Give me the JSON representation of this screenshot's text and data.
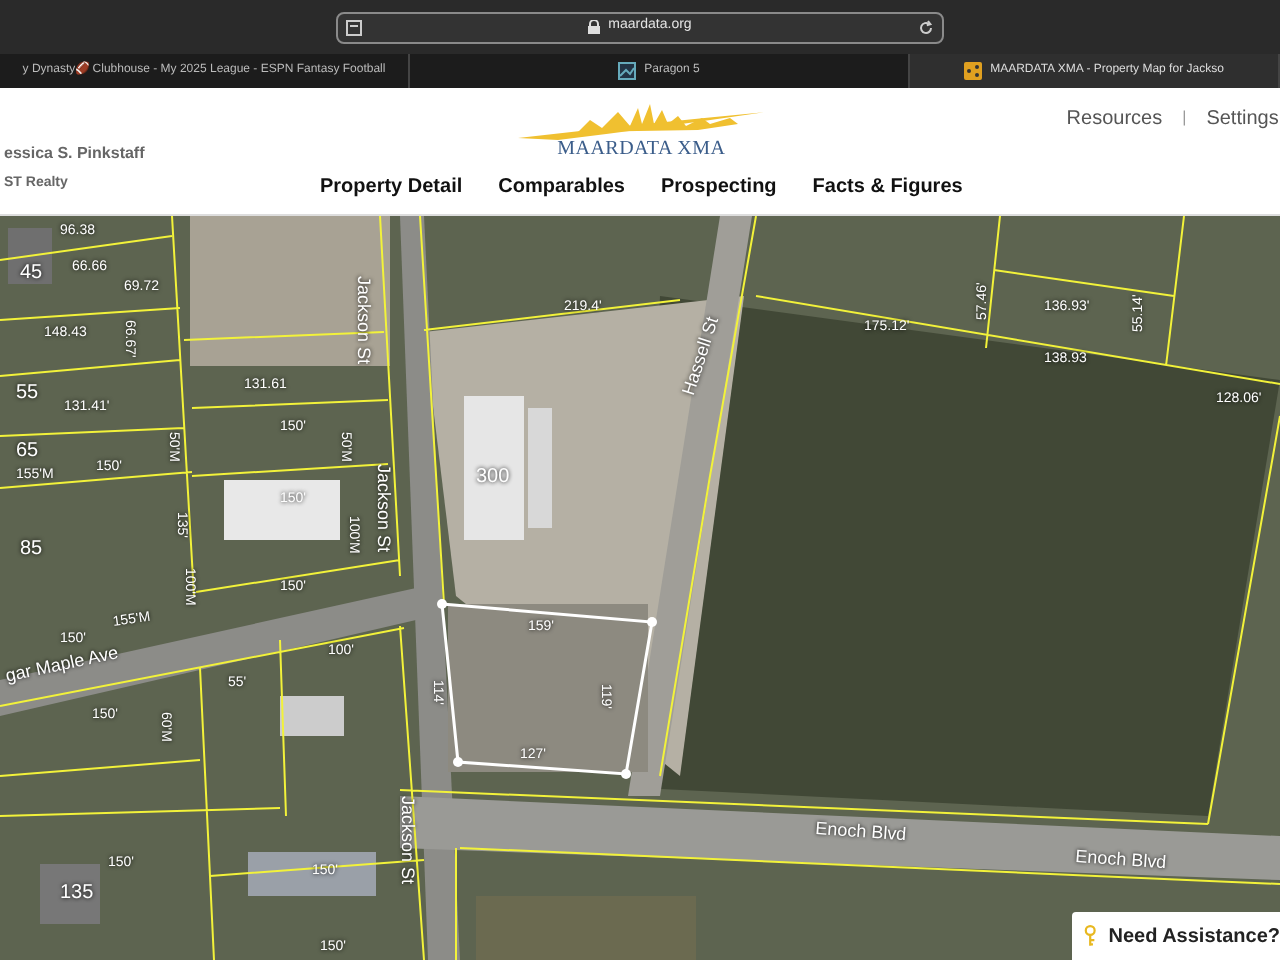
{
  "browser": {
    "url": "maardata.org",
    "tabs": [
      {
        "title": "y Dynasty🏈 Clubhouse - My 2025 League - ESPN Fantasy Football",
        "selected": false
      },
      {
        "title": "Paragon 5",
        "selected": false
      },
      {
        "title": "MAARDATA XMA - Property Map for Jackso",
        "selected": true
      }
    ]
  },
  "header": {
    "user": {
      "name": "essica S. Pinkstaff",
      "company": "ST Realty"
    },
    "logo": "MAARDATA XMA",
    "nav": [
      "Property Detail",
      "Comparables",
      "Prospecting",
      "Facts & Figures"
    ],
    "links": [
      "Resources",
      "Settings"
    ],
    "separator": "|"
  },
  "map": {
    "labels": [
      {
        "text": "96.38",
        "kind": "dimension"
      },
      {
        "text": "45",
        "kind": "lot"
      },
      {
        "text": "66.66",
        "kind": "dimension"
      },
      {
        "text": "69.72",
        "kind": "dimension"
      },
      {
        "text": "148.43",
        "kind": "dimension"
      },
      {
        "text": "66.67'",
        "kind": "dimension"
      },
      {
        "text": "55",
        "kind": "lot"
      },
      {
        "text": "131.41'",
        "kind": "dimension"
      },
      {
        "text": "65",
        "kind": "lot"
      },
      {
        "text": "155'M",
        "kind": "dimension"
      },
      {
        "text": "150'",
        "kind": "dimension"
      },
      {
        "text": "85",
        "kind": "lot"
      },
      {
        "text": "131.61",
        "kind": "dimension"
      },
      {
        "text": "150'",
        "kind": "dimension"
      },
      {
        "text": "50'M",
        "kind": "dimension"
      },
      {
        "text": "50'M",
        "kind": "dimension"
      },
      {
        "text": "150'",
        "kind": "dimension"
      },
      {
        "text": "135'",
        "kind": "dimension"
      },
      {
        "text": "100'M",
        "kind": "dimension"
      },
      {
        "text": "100'M",
        "kind": "dimension"
      },
      {
        "text": "150'",
        "kind": "dimension"
      },
      {
        "text": "Jackson St",
        "kind": "street"
      },
      {
        "text": "Jackson St",
        "kind": "street"
      },
      {
        "text": "219.4'",
        "kind": "dimension"
      },
      {
        "text": "300",
        "kind": "lot"
      },
      {
        "text": "Hassell St",
        "kind": "street"
      },
      {
        "text": "175.12'",
        "kind": "dimension"
      },
      {
        "text": "57.46'",
        "kind": "dimension"
      },
      {
        "text": "136.93'",
        "kind": "dimension"
      },
      {
        "text": "138.93",
        "kind": "dimension"
      },
      {
        "text": "55.14'",
        "kind": "dimension"
      },
      {
        "text": "128.06'",
        "kind": "dimension"
      },
      {
        "text": "150'",
        "kind": "dimension"
      },
      {
        "text": "155'M",
        "kind": "dimension"
      },
      {
        "text": "gar Maple Ave",
        "kind": "street"
      },
      {
        "text": "100'",
        "kind": "dimension"
      },
      {
        "text": "55'",
        "kind": "dimension"
      },
      {
        "text": "150'",
        "kind": "dimension"
      },
      {
        "text": "60'M",
        "kind": "dimension"
      },
      {
        "text": "159'",
        "kind": "dimension"
      },
      {
        "text": "114'",
        "kind": "dimension"
      },
      {
        "text": "119'",
        "kind": "dimension"
      },
      {
        "text": "127'",
        "kind": "dimension"
      },
      {
        "text": "Enoch Blvd",
        "kind": "street"
      },
      {
        "text": "Enoch Blvd",
        "kind": "street"
      },
      {
        "text": "135",
        "kind": "lot"
      },
      {
        "text": "150'",
        "kind": "dimension"
      },
      {
        "text": "150'",
        "kind": "dimension"
      },
      {
        "text": "150'",
        "kind": "dimension"
      },
      {
        "text": "Jackson St",
        "kind": "street"
      }
    ]
  },
  "help": {
    "label": "Need Assistance?"
  }
}
